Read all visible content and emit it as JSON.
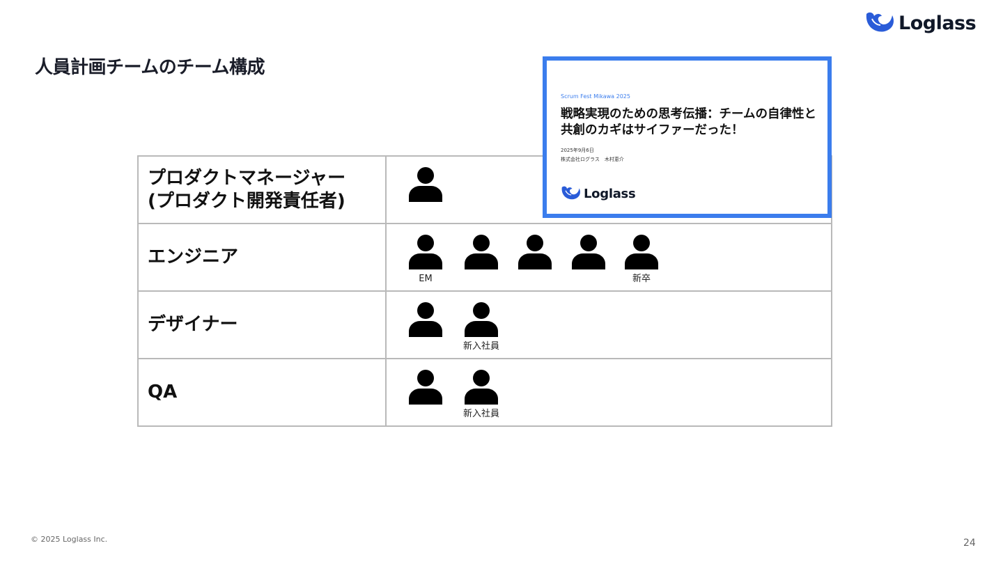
{
  "logo": {
    "text": "Loglass"
  },
  "page_title": "人員計画チームのチーム構成",
  "team": [
    {
      "role_line1": "プロダクトマネージャー",
      "role_line2": "(プロダクト開発責任者)",
      "members": [
        {
          "label": ""
        }
      ]
    },
    {
      "role_line1": "エンジニア",
      "role_line2": "",
      "members": [
        {
          "label": "EM"
        },
        {
          "label": ""
        },
        {
          "label": ""
        },
        {
          "label": ""
        },
        {
          "label": "新卒"
        }
      ]
    },
    {
      "role_line1": "デザイナー",
      "role_line2": "",
      "members": [
        {
          "label": ""
        },
        {
          "label": "新入社員"
        }
      ]
    },
    {
      "role_line1": "QA",
      "role_line2": "",
      "members": [
        {
          "label": ""
        },
        {
          "label": "新入社員"
        }
      ]
    }
  ],
  "cover_slide": {
    "event": "Scrum Fest Mikawa 2025",
    "title": "戦略実現のための思考伝播：チームの自律性と共創のカギはサイファーだった！",
    "date": "2025年9月6日",
    "company": "株式会社ログラス　木村恵介",
    "logo_text": "Loglass"
  },
  "footer": {
    "copyright": "© 2025 Loglass Inc.",
    "page_number": "24"
  },
  "colors": {
    "accent": "#3b7ded",
    "brand_blue": "#2a5cd8",
    "table_border": "#b9b9b9"
  },
  "icons": [
    "whale-logo-icon",
    "person-icon"
  ]
}
